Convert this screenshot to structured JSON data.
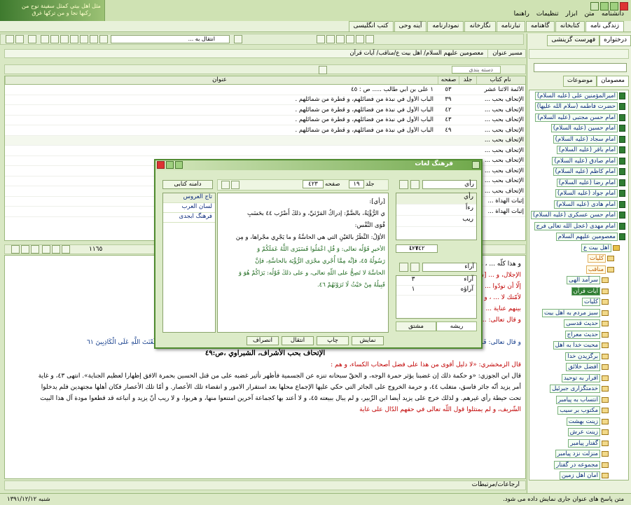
{
  "app": {
    "logo_text": "مثل اهل بيتي كمثل سفينة نوح من ركبها نجا و من تركها غرق",
    "menu": [
      "دانشنامه",
      "متن",
      "ابزار",
      "تنظیمات",
      "راهنما"
    ]
  },
  "tabs": [
    "زندگی نامه",
    "کتابخانه",
    "گاهنامه",
    "تبارنامه",
    "نگارخانه",
    "نمودارنامه",
    "آینه وحی",
    "کتب انگلیسی"
  ],
  "toolbar": {
    "goto_placeholder": "انتقال به ..."
  },
  "right_panel": {
    "tabs": [
      "درختواره",
      "فهرست گزینشی"
    ],
    "subtabs": [
      "معصومان",
      "موضوعات"
    ],
    "tree": [
      {
        "label": "امیرالمؤمنین علی (علیه السلام)",
        "type": "book"
      },
      {
        "label": "حضرت فاطمه (سلام الله علیها)",
        "type": "book"
      },
      {
        "label": "امام حسن مجتبی (علیه السلام)",
        "type": "book"
      },
      {
        "label": "امام حسین (علیه السلام)",
        "type": "book"
      },
      {
        "label": "امام سجاد (علیه السلام)",
        "type": "book"
      },
      {
        "label": "امام باقر (علیه السلام)",
        "type": "book"
      },
      {
        "label": "امام صادق (علیه السلام)",
        "type": "book"
      },
      {
        "label": "امام کاظم (علیه السلام)",
        "type": "book"
      },
      {
        "label": "امام رضا (علیه السلام)",
        "type": "book"
      },
      {
        "label": "امام جواد (علیه السلام)",
        "type": "book"
      },
      {
        "label": "امام هادی (علیه السلام)",
        "type": "book"
      },
      {
        "label": "امام حسن عسکری (علیه السلام)",
        "type": "book"
      },
      {
        "label": "امام مهدی (عجل الله تعالی فرج",
        "type": "book"
      },
      {
        "label": "معصومین علیهم السلام",
        "type": "book"
      },
      {
        "label": "اهل بیت ع",
        "type": "fold"
      },
      {
        "label": "کلیات",
        "type": "or"
      },
      {
        "label": "مناقب",
        "type": "or"
      },
      {
        "label": "سرآمد الهی",
        "type": "item"
      },
      {
        "label": "آیات قرآن",
        "type": "sel"
      },
      {
        "label": "کلیات",
        "type": "item"
      },
      {
        "label": "سبز مردم به اهل بیت",
        "type": "item"
      },
      {
        "label": "حدیث قدسی",
        "type": "item"
      },
      {
        "label": "حدیث معراج",
        "type": "item"
      },
      {
        "label": "محبت خدا به اهل",
        "type": "item"
      },
      {
        "label": "برگزیدن خدا",
        "type": "item"
      },
      {
        "label": "افضل خلائق",
        "type": "item"
      },
      {
        "label": "اقرار به توحید",
        "type": "item"
      },
      {
        "label": "خدمتگزاری جبرئیل",
        "type": "item"
      },
      {
        "label": "انتساب به پیامبر",
        "type": "item"
      },
      {
        "label": "مکتوب بر سیب",
        "type": "item"
      },
      {
        "label": "زینت بهشت",
        "type": "item"
      },
      {
        "label": "زینت عرش",
        "type": "item"
      },
      {
        "label": "گفتار پیامبر",
        "type": "item"
      },
      {
        "label": "منزلت نزد پیامبر",
        "type": "item"
      },
      {
        "label": "مجموعه در گفتار",
        "type": "item"
      },
      {
        "label": "امان اهل زمین",
        "type": "item"
      }
    ]
  },
  "path": {
    "label": "مسیر عنوان",
    "value": "معصومین علیهم السلام/ اهل بیت ع/مناقب/ آیات قرآن"
  },
  "grid": {
    "category_label": "دسته بندی",
    "headers": [
      "نام کتاب",
      "جلد",
      "صفحه",
      "عنوان"
    ],
    "rows": [
      {
        "book": "الأئمة الاثنا عشر",
        "vol": "",
        "page": "٥٣",
        "title": "١ علی بن أبي طالب ..... ص : ٤٥"
      },
      {
        "book": "الإتحاف بحب ...",
        "vol": "",
        "page": "٣٩",
        "title": "الباب الأول في نبذة من فضائلهم، و قطرة من شمائلهم ."
      },
      {
        "book": "الإتحاف بحب ...",
        "vol": "",
        "page": "٤٢",
        "title": "الباب الأول في نبذة من فضائلهم، و قطرة من شمائلهم ."
      },
      {
        "book": "الإتحاف بحب ...",
        "vol": "",
        "page": "٤٣",
        "title": "الباب الأول في نبذة من فضائلهم، و قطرة من شمائلهم ."
      },
      {
        "book": "الإتحاف بحب ...",
        "vol": "",
        "page": "٤٩",
        "title": "الباب الأول في نبذة من فضائلهم، و قطرة من شمائلهم ."
      },
      {
        "book": "الإتحاف بحب ...",
        "vol": "",
        "page": "",
        "title": ""
      },
      {
        "book": "الإتحاف بحب ...",
        "vol": "",
        "page": "",
        "title": ""
      },
      {
        "book": "الإتحاف بحب ...",
        "vol": "",
        "page": "",
        "title": ""
      },
      {
        "book": "الإتحاف بحب ...",
        "vol": "",
        "page": "",
        "title": ""
      },
      {
        "book": "الإتحاف بحب ...",
        "vol": "",
        "page": "",
        "title": ""
      },
      {
        "book": "الإتحاف بحب ...",
        "vol": "",
        "page": "",
        "title": ""
      },
      {
        "book": "إثبات الهداة ...",
        "vol": "",
        "page": "",
        "title": ""
      },
      {
        "book": "إثبات الهداة ...",
        "vol": "",
        "page": "",
        "title": ""
      }
    ],
    "count": "١١٦٥"
  },
  "content": {
    "lines": [
      {
        "t": "و هذا كلّه ... ، و دمه الكريمين فيهم، فهم بعضه، و بعضه في وجوب",
        "c": ""
      },
      {
        "t": "الإجلال، و ... [سورة الشورى ٤٣١]، قال ابن عباس: «المعنى لا أسألكم عليه أجرا",
        "c": "red"
      },
      {
        "t": "إلّا أن تودّوا ... ما قاله غيره في تفسير الآية: «إنّ المعنى قل يا محمّد",
        "c": "red"
      },
      {
        "t": "لأمّتك لا ... ، و تعاملوهم بالمعروف، و الإحسان، و يكون بينكم، و",
        "c": "red"
      },
      {
        "t": "بينهم عناية ...",
        "c": "red"
      },
      {
        "t": "و قال تعالى: ...",
        "c": "red"
      },
      {
        "t": "الإتحاف بحب الأشراف، الشبراوي ،ص:٤٣",
        "c": "hd"
      },
      {
        "t": "و قال تعالى: فَمَنْ حَاجَّكَ فِيهِ مِنْ بَعْدِ مَا جَاءَكَ مِنَ الْعِلْمِ فَقُلْ تَعَالَوْا نَدْعُ أَبْنَاءَنَا وَ أَبْنَاءَكُمْ وَ نِسَاءَنَا وَ نِسَاءَكُمْ وَ أَنْفُسَنَا وَ أَنْفُسَكُمْ ثُمَّ نَبْتَهِلْ فَنَجْعَلْ لَعْنَتَ اللَّهِ عَلَى الْكَاذِبِينَ ٦١",
        "c": "blue"
      },
      {
        "t": "الإتحاف بحب الأشراف، الشبراوي ،ص:٤٩",
        "c": "hd"
      },
      {
        "t": "قال الزمخشري: «لا دليل أقوى من هذا على فضل أصحاب الكساء، و هم :",
        "c": "red"
      },
      {
        "t": "قال ابن الجوزي: «و حكمة ذلك إن غضبنا يؤثر حمرة الوجه، و الحقّ سبحانه تنزه عن الجسمية فأظهر تأثير غضبه على من قتل الحسين بحمرة الافق إظهارا لعظيم الجناية». انتهى ٤٣، و غاية",
        "c": ""
      },
      {
        "t": "أمر يزيد أنّه جائر فاسق، متغلب ٤٤، و حرمة الخروج على الجائر التي حكي عليها الإجماع محلها بعد استقرار الامور و انقضاء تلك الأعصار. و أمّا تلك الأعصار فكان أهلها مجتهدين فلم يدخلوا",
        "c": ""
      },
      {
        "t": "تحت حيطة رأي غيرهم. و لذلك خرج على يزيد أيضا ابن الزّبير، و لم يبال ببيعته ٤٥، و لا أعتد بها كجماعة آخرين امتنعوا منها، و هربوا، و لا ريب أنّ يزيد و أتباعه قد قطعوا مودة آل هذا البيت",
        "c": ""
      },
      {
        "t": "الشّريف، و لم يمتثلوا قول اللّه تعالى في حقهم الدّال على غاية",
        "c": "red"
      }
    ]
  },
  "bottom_tab": "ارجاعات/مرتبطات",
  "status": {
    "date": "شنبه ١٣٩١/١٢/١٢",
    "message": "متن پاسخ های عنوان جاری نمایش داده می شود."
  },
  "dialog": {
    "title": "فرهنگ لغات",
    "search_value": "رأي",
    "words": [
      "رأي",
      "رءاً",
      "ريب"
    ],
    "count_left": "١٢٣٤٢",
    "count_right": "٤٠٧",
    "search2_value": "آراء",
    "words2": [
      {
        "w": "آراء",
        "n": "٣"
      },
      {
        "w": "آراؤه",
        "n": "١"
      }
    ],
    "tabs_left": [
      "ریشه",
      "مشتق"
    ],
    "vol_label": "جلد",
    "vol_value": "١٩",
    "page_label": "صفحه",
    "page_value": "٤٢٣",
    "scope_label": "دامنه کتابی",
    "dicts": [
      "تاج العروس",
      "لسان العرب",
      "فرهنگ ابجدی"
    ],
    "def_lines": [
      "[رأي]:",
      "ي الرُّؤْيَةُ، بالضَّمِّ: إدراكُ المَرْئيِّ، و ذلكَ أَضْرُب ٤٤ بحَسَبِ",
      "قُوَى النَّفْس:",
      "الأوّلُ: النَّظَرُ بالعَيْنِ التي هي الحاسَّةُ و ما يَجْرِي مجْراها، و مِن",
      "الأخيرِ قَوْلُه تعالى: وَ قُلِ اعْمَلُوا فَسَيَرَى اللَّهُ عَمَلَكُمْ وَ",
      "رَسُولُهُ ٤٥، فإنَّه مِمَّا أُجْري مجْرَى الرُّؤْيَة بالحاسَّةِ، فإنَّ",
      "الحاسَّةَ لا تَصِحُّ على اللّهِ تعالى، و على ذلكَ قَوْلُه: يَرَاكُمْ هُوَ وَ",
      "قَبِيلُهُ مِنْ حَيْثُ لَا تَرَوْنَهُمْ ٤٦."
    ],
    "buttons": [
      "نمایش",
      "چاپ",
      "انتقال",
      "انصراف"
    ]
  }
}
